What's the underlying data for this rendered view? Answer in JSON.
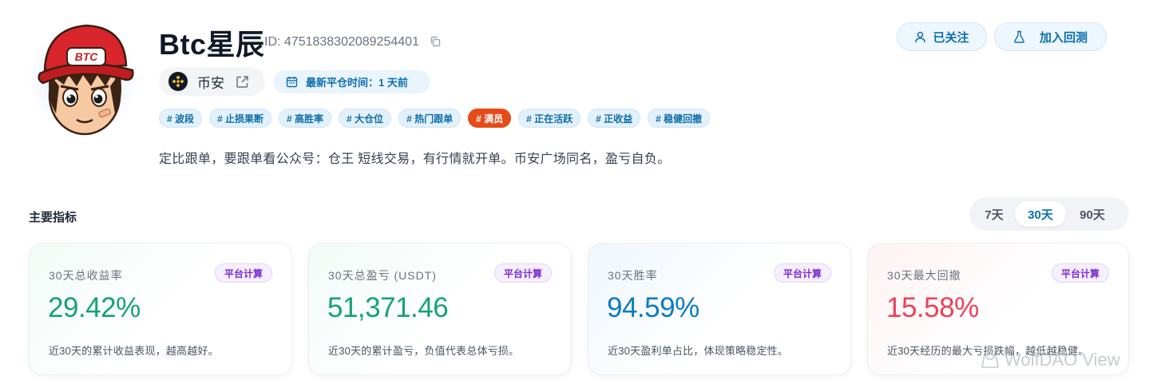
{
  "profile": {
    "name": "Btc星辰",
    "id_label": "ID: 4751838302089254401",
    "cap_text": "BTC",
    "exchange": "币安",
    "latest_close": "最新平仓时间：1 天前",
    "description": "定比跟单，要跟单看公众号：仓王 短线交易，有行情就开单。币安广场同名，盈亏自负。"
  },
  "actions": {
    "follow_label": "已关注",
    "backtest_label": "加入回测"
  },
  "tags": [
    {
      "label": "# 波段",
      "highlight": false
    },
    {
      "label": "# 止损果断",
      "highlight": false
    },
    {
      "label": "# 高胜率",
      "highlight": false
    },
    {
      "label": "# 大仓位",
      "highlight": false
    },
    {
      "label": "# 热门跟单",
      "highlight": false
    },
    {
      "label": "# 满员",
      "highlight": true
    },
    {
      "label": "# 正在活跃",
      "highlight": false
    },
    {
      "label": "# 正收益",
      "highlight": false
    },
    {
      "label": "# 稳健回撤",
      "highlight": false
    }
  ],
  "metrics": {
    "title": "主要指标",
    "ranges": [
      "7天",
      "30天",
      "90天"
    ],
    "selected_range": "30天",
    "cards": [
      {
        "label": "30天总收益率",
        "badge": "平台计算",
        "value": "29.42%",
        "note": "近30天的累计收益表现，越高越好。"
      },
      {
        "label": "30天总盈亏 (USDT)",
        "badge": "平台计算",
        "value": "51,371.46",
        "note": "近30天的累计盈亏，负值代表总体亏损。"
      },
      {
        "label": "30天胜率",
        "badge": "平台计算",
        "value": "94.59%",
        "note": "近30天盈利单占比，体现策略稳定性。"
      },
      {
        "label": "30天最大回撤",
        "badge": "平台计算",
        "value": "15.58%",
        "note": "近30天经历的最大亏损跌幅，越低越稳健。"
      }
    ]
  },
  "colors": {
    "accent": "#0b6fb0",
    "positive": "#16a373",
    "winrate": "#0b7cc2",
    "drawdown": "#ec4159",
    "hot_tag": "#e64a19"
  },
  "watermark": "WolfDAO View"
}
